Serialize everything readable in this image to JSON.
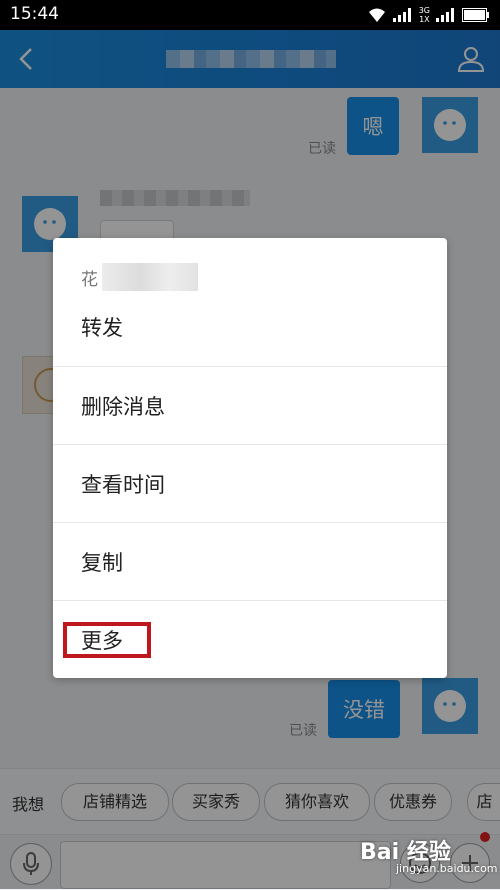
{
  "status_bar": {
    "time": "15:44",
    "network_top": "3G",
    "network_bottom": "1X"
  },
  "header": {
    "back_icon": "chevron-left-icon",
    "profile_icon": "user-icon"
  },
  "messages": [
    {
      "direction": "out",
      "text": "嗯",
      "status": "已读"
    },
    {
      "direction": "out",
      "text": "没错",
      "status": "已读"
    }
  ],
  "context_menu": {
    "header_prefix": "花",
    "items": [
      "转发",
      "删除消息",
      "查看时间",
      "复制",
      "更多"
    ],
    "highlighted_item": "更多"
  },
  "quick_bar": {
    "label": "我想",
    "chips": [
      "店铺精选",
      "买家秀",
      "猜你喜欢",
      "优惠券",
      "店"
    ]
  },
  "input_bar": {
    "placeholder": ""
  },
  "watermark": {
    "logo": "Bai 经验",
    "url": "jingyan.baidu.com"
  },
  "colors": {
    "accent": "#1890e8",
    "highlight": "#c0161e"
  }
}
